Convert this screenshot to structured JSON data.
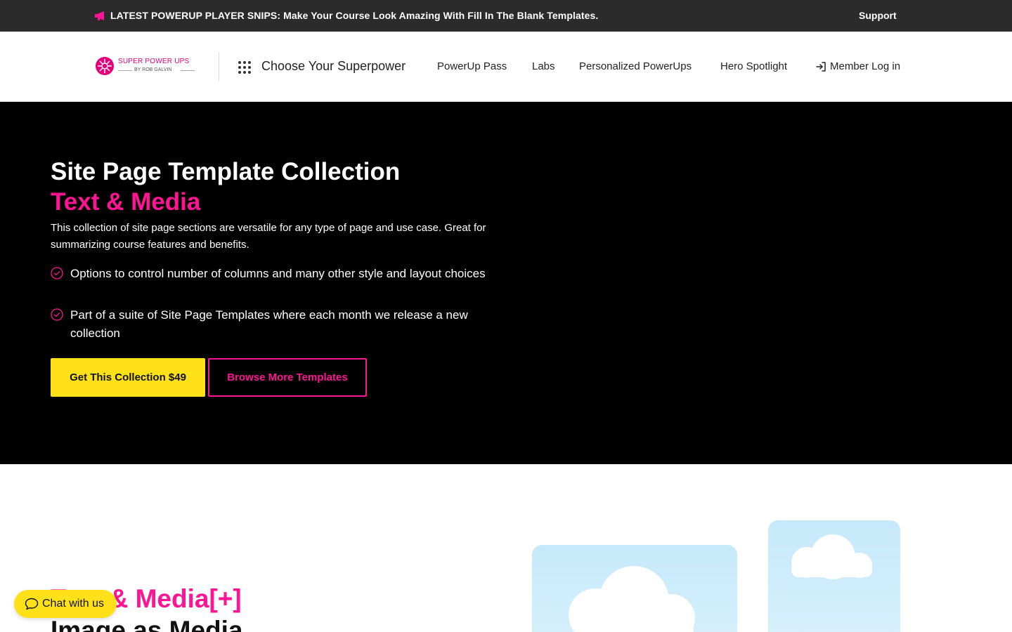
{
  "announcement": {
    "icon": "megaphone-icon",
    "text": "LATEST POWERUP PLAYER SNIPS: Make Your Course Look Amazing With Fill In The Blank Templates.",
    "support_label": "Support"
  },
  "header": {
    "logo": {
      "name": "SUPER POWER UPS",
      "byline": "BY ROB GALVIN"
    },
    "choose_label": "Choose Your Superpower",
    "nav": [
      {
        "label": "PowerUp Pass"
      },
      {
        "label": "Labs"
      },
      {
        "label": "Personalized PowerUps"
      },
      {
        "label": "Hero Spotlight"
      }
    ],
    "login_label": "Member Log in",
    "login_icon": "login-arrow-icon"
  },
  "hero": {
    "title": "Site Page Template Collection",
    "subtitle": "Text & Media",
    "description": "This collection of site page sections are versatile for any type of page and use case. Great for summarizing course features and benefits.",
    "bullets": [
      "Options to control number of columns and many other style and layout choices",
      "Part of a suite of Site Page Templates where each month we release a new collection"
    ],
    "primary_button": "Get This Collection $49",
    "secondary_button": "Browse More Templates"
  },
  "section2": {
    "kicker": "Text & Media[+]",
    "title": "Image as Media"
  },
  "chat": {
    "label": "Chat with us",
    "icon": "chat-bubble-icon"
  },
  "colors": {
    "accent_pink": "#ff1493",
    "accent_yellow": "#ffe119",
    "topbar_bg": "#2b2b2b",
    "hero_bg": "#000000"
  }
}
